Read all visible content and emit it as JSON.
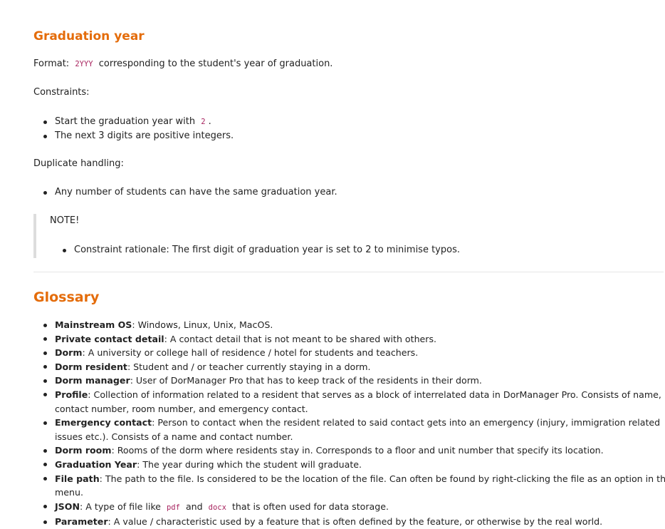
{
  "graduation": {
    "heading": "Graduation year",
    "format_label": "Format:",
    "format_code": "2YYY",
    "format_text": "corresponding to the student's year of graduation.",
    "constraints_label": "Constraints:",
    "constraint_1_text": "Start the graduation year with",
    "constraint_1_code": "2",
    "constraint_1_end": ".",
    "constraint_2_text": "The next 3 digits are positive integers.",
    "duplicate_label": "Duplicate handling:",
    "duplicate_1_text": "Any number of students can have the same graduation year.",
    "note_label": "NOTE!",
    "note_1_text": "Constraint rationale: The first digit of graduation year is set to 2 to minimise typos."
  },
  "glossary": {
    "heading": "Glossary",
    "items": [
      {
        "term": "Mainstream OS",
        "definition": ": Windows, Linux, Unix, MacOS."
      },
      {
        "term": "Private contact detail",
        "definition": ": A contact detail that is not meant to be shared with others."
      },
      {
        "term": "Dorm",
        "definition": ": A university or college hall of residence / hotel for students and teachers."
      },
      {
        "term": "Dorm resident",
        "definition": ": Student and / or teacher currently staying in a dorm."
      },
      {
        "term": "Dorm manager",
        "definition": ": User of DorManager Pro that has to keep track of the residents in their dorm."
      },
      {
        "term": "Profile",
        "definition": ": Collection of information related to a resident that serves as a block of interrelated data in DorManager Pro. Consists of name, contact number, room number, and emergency contact."
      },
      {
        "term": "Emergency contact",
        "definition": ": Person to contact when the resident related to said contact gets into an emergency (injury, immigration related issues etc.). Consists of a name and contact number."
      },
      {
        "term": "Dorm room",
        "definition": ": Rooms of the dorm where residents stay in. Corresponds to a floor and unit number that specify its location."
      },
      {
        "term": "Graduation Year",
        "definition": ": The year during which the student will graduate."
      },
      {
        "term": "File path",
        "definition": ": The path to the file. Is considered to be the location of the file. Can often be found by right-clicking the file as an option in the menu."
      },
      {
        "term": "JSON",
        "definition_before": ": A type of file like",
        "code_1": "pdf",
        "definition_mid": "and",
        "code_2": "docx",
        "definition_after": "that is often used for data storage."
      },
      {
        "term": "Parameter",
        "definition": ": A value / characteristic used by a feature that is often defined by the feature, or otherwise by the real world."
      }
    ]
  }
}
